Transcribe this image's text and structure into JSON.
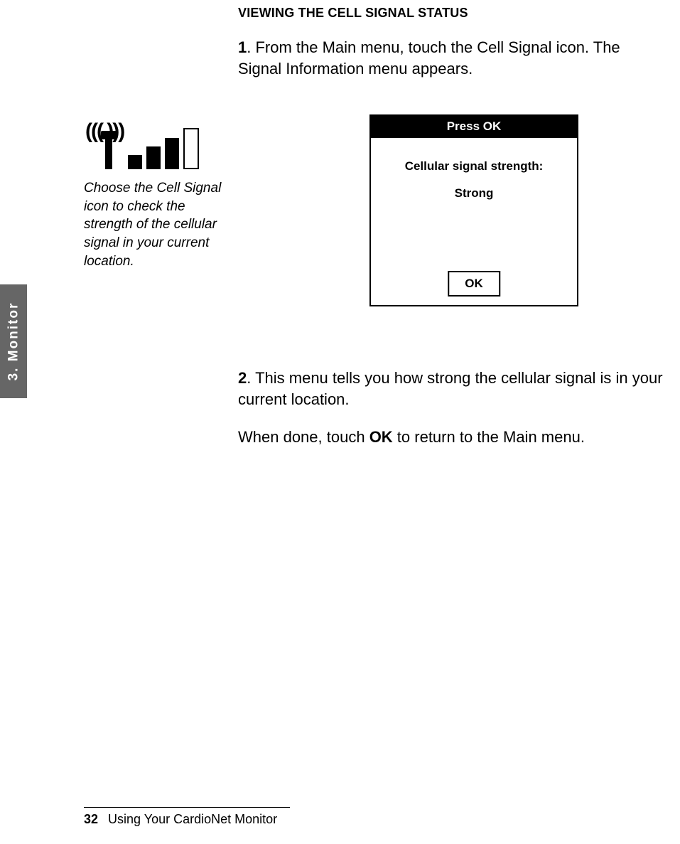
{
  "heading": "VIEWING THE CELL SIGNAL STATUS",
  "step1_num": "1",
  "step1_text": ". From the Main menu, touch the Cell Signal icon. The Signal Information menu appears.",
  "left_caption": "Choose the Cell Signal icon to check the strength of the cellular signal in your current location.",
  "device": {
    "titlebar": "Press OK",
    "msg1": "Cellular signal strength:",
    "msg2": "Strong",
    "ok_label": "OK"
  },
  "step2_num": "2",
  "step2_text": ". This menu tells you how strong the cellular signal is in your current location.",
  "step2_finish_prefix": "When done, touch ",
  "step2_finish_bold": "OK",
  "step2_finish_suffix": " to return to the Main menu.",
  "side_tab": "3. Monitor",
  "footer": {
    "page_number": "32",
    "title": "Using Your CardioNet Monitor"
  },
  "signal_waves": "((( )))"
}
